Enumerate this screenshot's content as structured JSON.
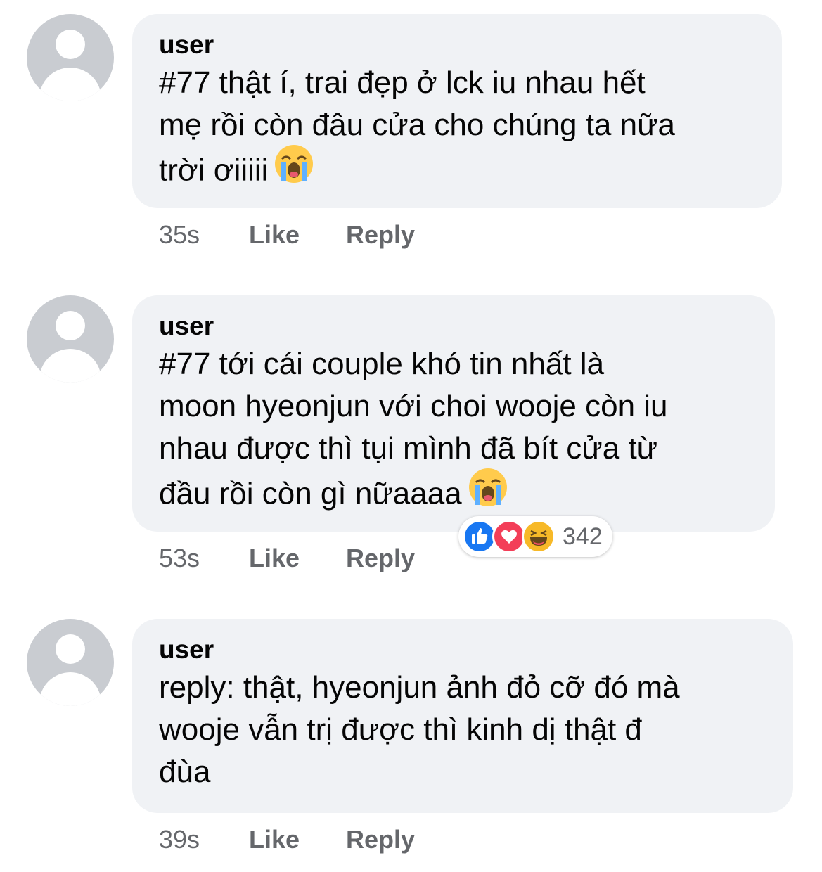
{
  "comments": [
    {
      "author": "user",
      "text": "#77 thật í, trai đẹp ở lck iu nhau hết\nmẹ rồi còn đâu cửa cho chúng ta nữa\ntrời ơiiiii",
      "emoji": "loudly-crying-face",
      "time": "35s",
      "like_label": "Like",
      "reply_label": "Reply"
    },
    {
      "author": "user",
      "text": "#77 tới cái couple khó tin nhất là\nmoon hyeonjun với choi wooje còn iu\nnhau được thì tụi mình đã bít cửa từ\nđầu rồi còn gì nữaaaa",
      "emoji": "loudly-crying-face",
      "time": "53s",
      "like_label": "Like",
      "reply_label": "Reply",
      "reactions": {
        "icons": [
          "like-reaction-icon",
          "love-reaction-icon",
          "haha-reaction-icon"
        ],
        "count": "342"
      }
    },
    {
      "author": "user",
      "text": "reply: thật, hyeonjun ảnh đỏ cỡ đó mà\nwooje vẫn trị được thì kinh dị thật đ\nđùa",
      "time": "39s",
      "like_label": "Like",
      "reply_label": "Reply"
    }
  ],
  "colors": {
    "bubble": "#f0f2f5",
    "meta_text": "#65676b",
    "like_blue": "#1877f2",
    "love_red": "#f33e58",
    "haha_yellow": "#f7b928"
  }
}
